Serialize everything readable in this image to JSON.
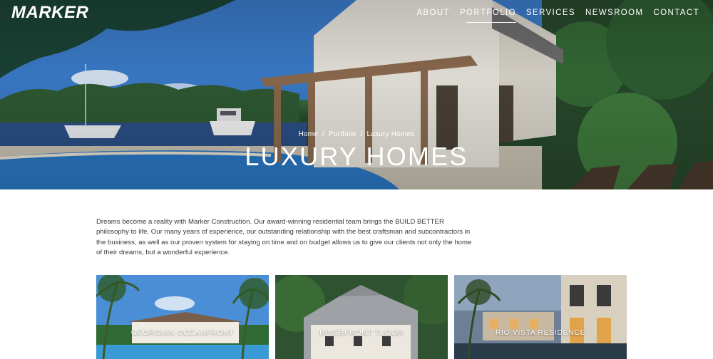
{
  "header": {
    "logo": "MARKER",
    "nav": [
      {
        "label": "ABOUT"
      },
      {
        "label": "PORTFOLIO",
        "active": true
      },
      {
        "label": "SERVICES"
      },
      {
        "label": "NEWSROOM"
      },
      {
        "label": "CONTACT"
      }
    ]
  },
  "hero": {
    "breadcrumb": [
      "Home",
      "Portfolio",
      "Luxury Homes"
    ],
    "title": "LUXURY HOMES"
  },
  "intro": {
    "text": "Dreams become a reality with Marker Construction. Our award-winning residential team brings the BUILD BETTER philosophy to life. Our many years of experience, our outstanding relationship with the best craftsman and subcontractors in the business, as well as our proven system for staying on time and on budget allows us to give our clients not only the home of their dreams, but a wonderful experience."
  },
  "projects": [
    {
      "label": "GEORGIAN OCEANFRONT"
    },
    {
      "label": "RIVERFRONT TUDOR"
    },
    {
      "label": "RIO VISTA RESIDENCE"
    }
  ],
  "colors": {
    "nav_text": "#ffffff",
    "body_text": "#3a3a3a",
    "background": "#ffffff"
  }
}
